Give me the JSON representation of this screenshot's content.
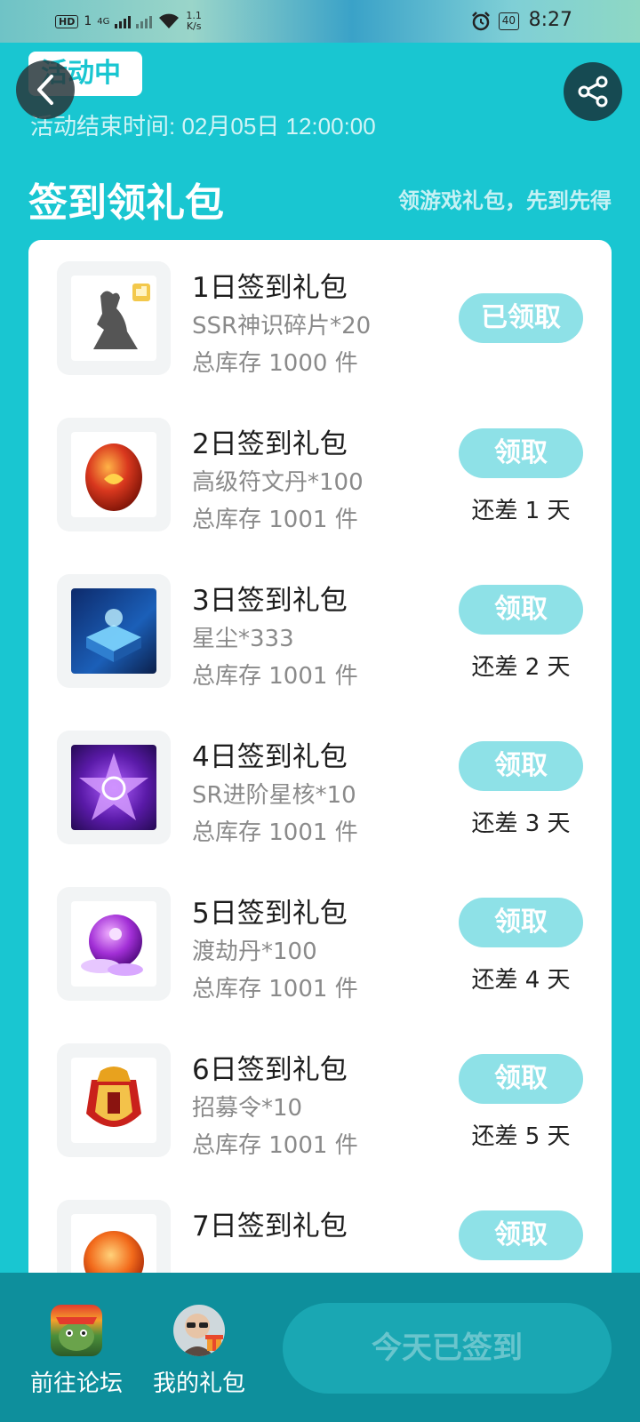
{
  "status_bar": {
    "hd_badge": "HD",
    "sim": "1",
    "network": "4G",
    "net_speed_value": "1.1",
    "net_speed_unit": "K/s",
    "battery": "40",
    "time": "8:27"
  },
  "header": {
    "status_label": "活动中",
    "end_time": "活动结束时间: 02月05日 12:00:00",
    "back_icon": "chevron-left-icon",
    "share_icon": "share-icon"
  },
  "section": {
    "title": "签到领礼包",
    "subtitle": "领游戏礼包，先到先得"
  },
  "gifts": [
    {
      "title": "1日签到礼包",
      "item": "SSR神识碎片*20",
      "stock": "总库存 1000 件",
      "button": "已领取",
      "days_left": "",
      "icon": "silhouette-shard-icon"
    },
    {
      "title": "2日签到礼包",
      "item": "高级符文丹*100",
      "stock": "总库存 1001 件",
      "button": "领取",
      "days_left": "还差 1 天",
      "icon": "rune-pill-icon"
    },
    {
      "title": "3日签到礼包",
      "item": "星尘*333",
      "stock": "总库存 1001 件",
      "button": "领取",
      "days_left": "还差 2 天",
      "icon": "stardust-box-icon"
    },
    {
      "title": "4日签到礼包",
      "item": "SR进阶星核*10",
      "stock": "总库存 1001 件",
      "button": "领取",
      "days_left": "还差 3 天",
      "icon": "star-core-icon"
    },
    {
      "title": "5日签到礼包",
      "item": "渡劫丹*100",
      "stock": "总库存 1001 件",
      "button": "领取",
      "days_left": "还差 4 天",
      "icon": "tribulation-pill-icon"
    },
    {
      "title": "6日签到礼包",
      "item": "招募令*10",
      "stock": "总库存 1001 件",
      "button": "领取",
      "days_left": "还差 5 天",
      "icon": "recruit-token-icon"
    },
    {
      "title": "7日签到礼包",
      "item": "",
      "stock": "",
      "button": "领取",
      "days_left": "",
      "icon": "orange-orb-icon"
    }
  ],
  "bottom_bar": {
    "forum_label": "前往论坛",
    "my_gifts_label": "我的礼包",
    "signin_label": "今天已签到"
  },
  "colors": {
    "background": "#19c6d1",
    "button": "#8ee1e7",
    "bottom_bar": "#0e8f9c"
  }
}
